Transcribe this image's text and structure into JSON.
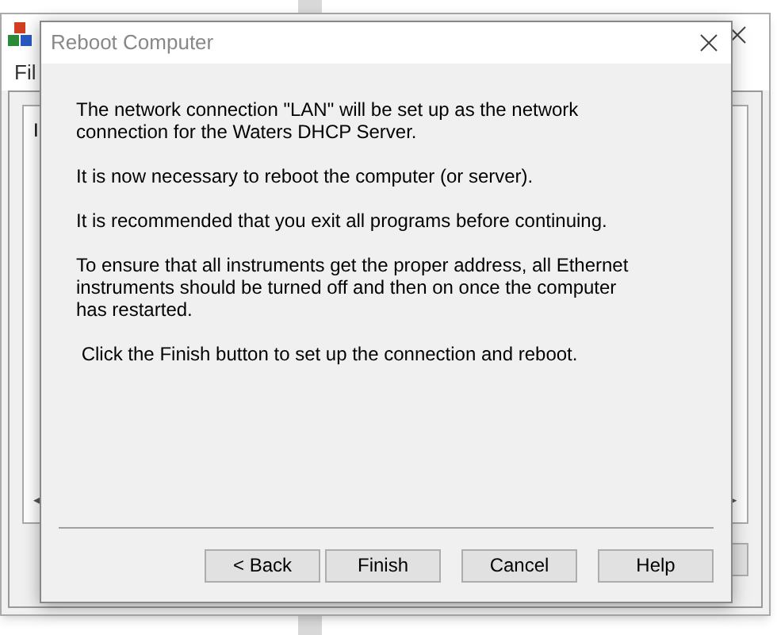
{
  "main_window": {
    "menu": [
      "Fil"
    ],
    "panel_text": "I"
  },
  "dialog": {
    "title": "Reboot Computer",
    "paragraphs": [
      "The network connection \"LAN\" will be set up as the network connection for the Waters DHCP Server.",
      "It is now necessary to reboot the computer (or server).",
      "It is recommended that you exit all programs before continuing.",
      "To ensure that all instruments get the proper address, all Ethernet instruments should be turned off and then on once the computer has restarted.",
      " Click the Finish button to set up the connection and reboot."
    ],
    "buttons": [
      {
        "label": "< Back",
        "kind": "left"
      },
      {
        "label": "Finish",
        "kind": "left"
      },
      {
        "label": "Cancel",
        "kind": "gap"
      },
      {
        "label": "Help",
        "kind": "gap"
      }
    ]
  }
}
